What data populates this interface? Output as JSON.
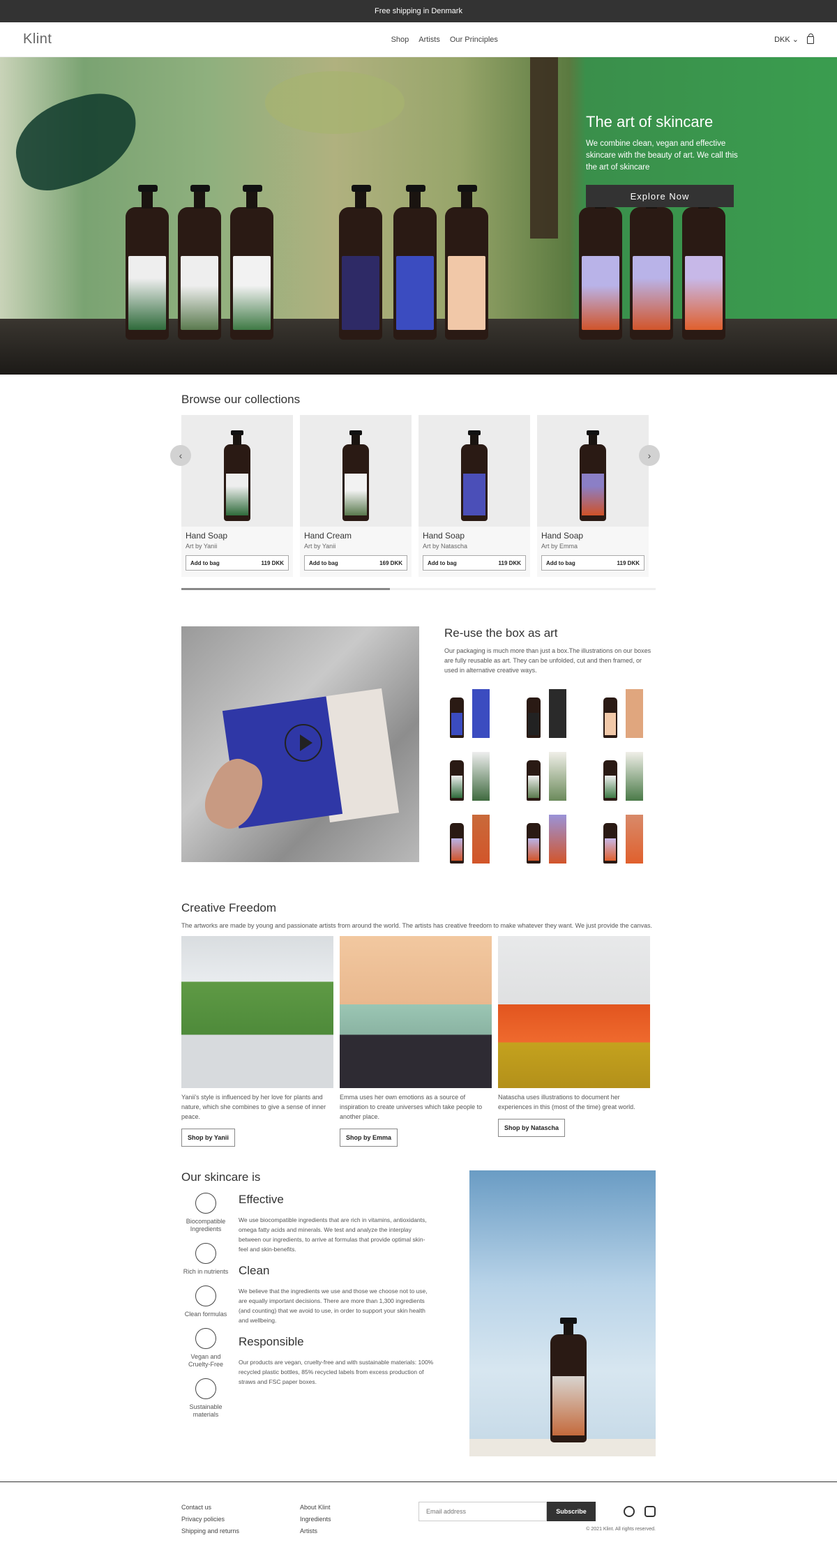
{
  "announcement": "Free shipping in Denmark",
  "header": {
    "logo": "Klint",
    "nav": [
      "Shop",
      "Artists",
      "Our Principles"
    ],
    "currency": "DKK"
  },
  "hero": {
    "title": "The art of skincare",
    "subtitle": "We combine clean, vegan and effective skincare with the beauty of art. We call this the art of skincare",
    "cta": "Explore Now"
  },
  "collections": {
    "title": "Browse our collections",
    "products": [
      {
        "name": "Hand Soap",
        "artist": "Art by Yanii",
        "cta": "Add to bag",
        "price": "119 DKK"
      },
      {
        "name": "Hand Cream",
        "artist": "Art by Yanii",
        "cta": "Add to bag",
        "price": "169 DKK"
      },
      {
        "name": "Hand Soap",
        "artist": "Art by Natascha",
        "cta": "Add to bag",
        "price": "119 DKK"
      },
      {
        "name": "Hand Soap",
        "artist": "Art by Emma",
        "cta": "Add to bag",
        "price": "119 DKK"
      }
    ],
    "scroll_progress": 0.44
  },
  "reuse": {
    "title": "Re-use the box as art",
    "description": "Our packaging is much more than just a box.The illustrations on our boxes are fully reusable as art. They can be unfolded, cut and then framed, or used in alternative creative ways."
  },
  "creative": {
    "title": "Creative Freedom",
    "description": "The artworks are made by young and passionate artists from around the world. The artists has creative freedom to make whatever they want. We just provide the canvas.",
    "artists": [
      {
        "caption": "Yanii's style is influenced by her love for plants and nature, which she combines to give a sense of inner peace.",
        "cta": "Shop by Yanii"
      },
      {
        "caption": "Emma uses her own emotions as a source of inspiration to create universes which take people to another place.",
        "cta": "Shop by Emma"
      },
      {
        "caption": "Natascha uses illustrations to document her experiences in this (most of the time) great world.",
        "cta": "Shop by Natascha"
      }
    ]
  },
  "skincare": {
    "title": "Our skincare is",
    "icons": [
      {
        "label": "Biocompatible Ingredients",
        "icon": "molecule-icon"
      },
      {
        "label": "Rich in nutrients",
        "icon": "nutrients-icon"
      },
      {
        "label": "Clean formulas",
        "icon": "test-tube-icon"
      },
      {
        "label": "Vegan and Cruelty-Free",
        "icon": "vegan-icon"
      },
      {
        "label": "Sustainable materials",
        "icon": "recycle-icon"
      }
    ],
    "blocks": [
      {
        "heading": "Effective",
        "text": "We use biocompatible ingredients that are rich in vitamins, antioxidants, omega fatty acids and minerals. We test and analyze the interplay between our ingredients, to arrive at formulas that provide optimal skin-feel and skin-benefits."
      },
      {
        "heading": "Clean",
        "text": "We believe that the ingredients we use and those we choose not to use, are equally important decisions. There are more than 1,300 ingredients (and counting) that we avoid to use, in order to support your skin health and wellbeing."
      },
      {
        "heading": "Responsible",
        "text": "Our products are vegan, cruelty-free and with sustainable materials: 100% recycled plastic bottles, 85% recycled labels from excess production of straws and FSC paper boxes."
      }
    ]
  },
  "footer": {
    "col1": [
      "Contact us",
      "Privacy policies",
      "Shipping and returns"
    ],
    "col2": [
      "About Klint",
      "Ingredients",
      "Artists"
    ],
    "email_placeholder": "Email address",
    "subscribe": "Subscribe",
    "copyright": "© 2021 Klint. All rights reserved."
  }
}
